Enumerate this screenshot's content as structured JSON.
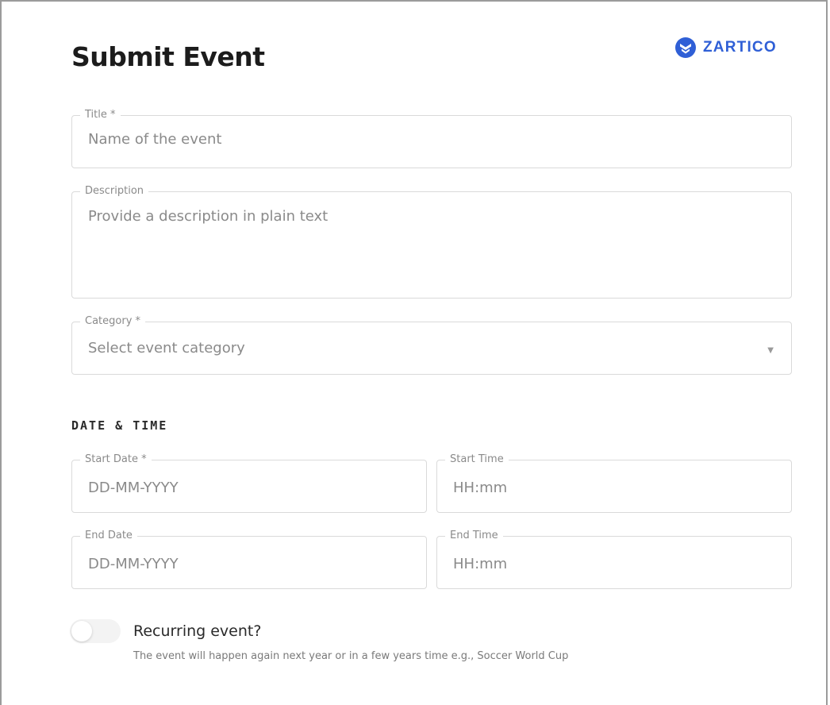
{
  "page": {
    "title": "Submit Event"
  },
  "brand": {
    "name": "ZARTICO",
    "color": "#2f5fd6"
  },
  "form": {
    "title": {
      "label": "Title *",
      "placeholder": "Name of the event",
      "value": ""
    },
    "description": {
      "label": "Description",
      "placeholder": "Provide a description in plain text",
      "value": ""
    },
    "category": {
      "label": "Category *",
      "placeholder": "Select event category",
      "selected": ""
    },
    "date_time": {
      "heading": "DATE & TIME",
      "start_date": {
        "label": "Start Date *",
        "placeholder": "DD-MM-YYYY"
      },
      "start_time": {
        "label": "Start Time",
        "placeholder": "HH:mm"
      },
      "end_date": {
        "label": "End Date",
        "placeholder": "DD-MM-YYYY"
      },
      "end_time": {
        "label": "End Time",
        "placeholder": "HH:mm"
      }
    },
    "recurring": {
      "label": "Recurring event?",
      "hint": "The event will happen again next year or in a few years time e.g., Soccer World Cup",
      "checked": false
    }
  },
  "icons": {
    "brand_logo": "zartico-shield-logo-icon",
    "category_dropdown": "chevron-down-icon"
  }
}
